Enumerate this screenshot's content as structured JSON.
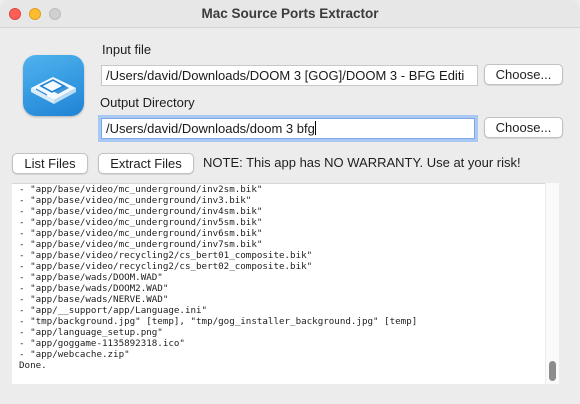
{
  "window": {
    "title": "Mac Source Ports Extractor"
  },
  "icons": {
    "app": "floppy-disk-icon"
  },
  "input": {
    "label": "Input file",
    "value": "/Users/david/Downloads/DOOM 3 [GOG]/DOOM 3 - BFG Editi",
    "choose_label": "Choose..."
  },
  "output": {
    "label": "Output Directory",
    "value": "/Users/david/Downloads/doom 3 bfg",
    "choose_label": "Choose..."
  },
  "actions": {
    "list_files_label": "List Files",
    "extract_files_label": "Extract Files",
    "note": "NOTE: This app has NO WARRANTY. Use at your risk!"
  },
  "log": {
    "lines": [
      "- \"app/base/video/mc_underground/inv2sm.bik\"",
      "- \"app/base/video/mc_underground/inv3.bik\"",
      "- \"app/base/video/mc_underground/inv4sm.bik\"",
      "- \"app/base/video/mc_underground/inv5sm.bik\"",
      "- \"app/base/video/mc_underground/inv6sm.bik\"",
      "- \"app/base/video/mc_underground/inv7sm.bik\"",
      "- \"app/base/video/recycling2/cs_bert01_composite.bik\"",
      "- \"app/base/video/recycling2/cs_bert02_composite.bik\"",
      "- \"app/base/wads/DOOM.WAD\"",
      "- \"app/base/wads/DOOM2.WAD\"",
      "- \"app/base/wads/NERVE.WAD\"",
      "- \"app/__support/app/Language.ini\"",
      "- \"tmp/background.jpg\" [temp], \"tmp/gog_installer_background.jpg\" [temp]",
      "- \"app/language_setup.png\"",
      "- \"app/goggame-1135892318.ico\"",
      "- \"app/webcache.zip\"",
      "Done."
    ]
  },
  "colors": {
    "focus_ring": "#a9c8f3",
    "window_bg": "#ececec",
    "icon_blue": "#2a8fe0"
  }
}
